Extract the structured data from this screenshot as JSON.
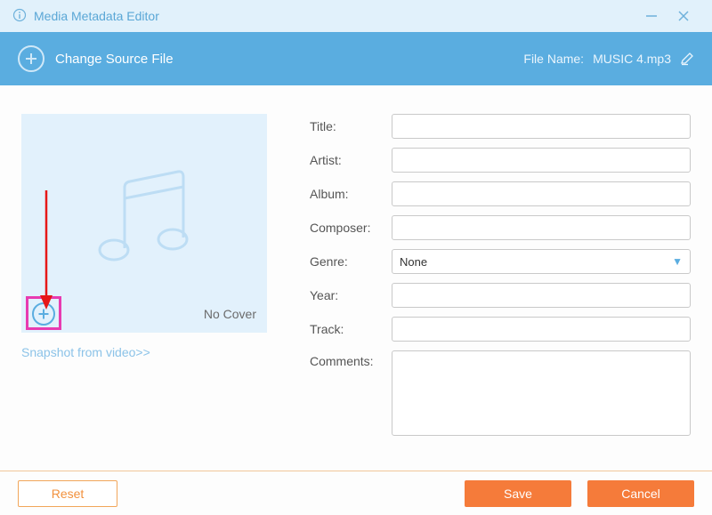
{
  "titlebar": {
    "title": "Media Metadata Editor"
  },
  "toolbar": {
    "change_source_label": "Change Source File",
    "file_name_label": "File Name:",
    "file_name_value": "MUSIC 4.mp3"
  },
  "cover": {
    "no_cover_label": "No Cover",
    "snapshot_link": "Snapshot from video>>"
  },
  "form": {
    "title_label": "Title:",
    "artist_label": "Artist:",
    "album_label": "Album:",
    "composer_label": "Composer:",
    "genre_label": "Genre:",
    "genre_value": "None",
    "year_label": "Year:",
    "track_label": "Track:",
    "comments_label": "Comments:",
    "title_value": "",
    "artist_value": "",
    "album_value": "",
    "composer_value": "",
    "year_value": "",
    "track_value": "",
    "comments_value": ""
  },
  "footer": {
    "reset_label": "Reset",
    "save_label": "Save",
    "cancel_label": "Cancel"
  }
}
